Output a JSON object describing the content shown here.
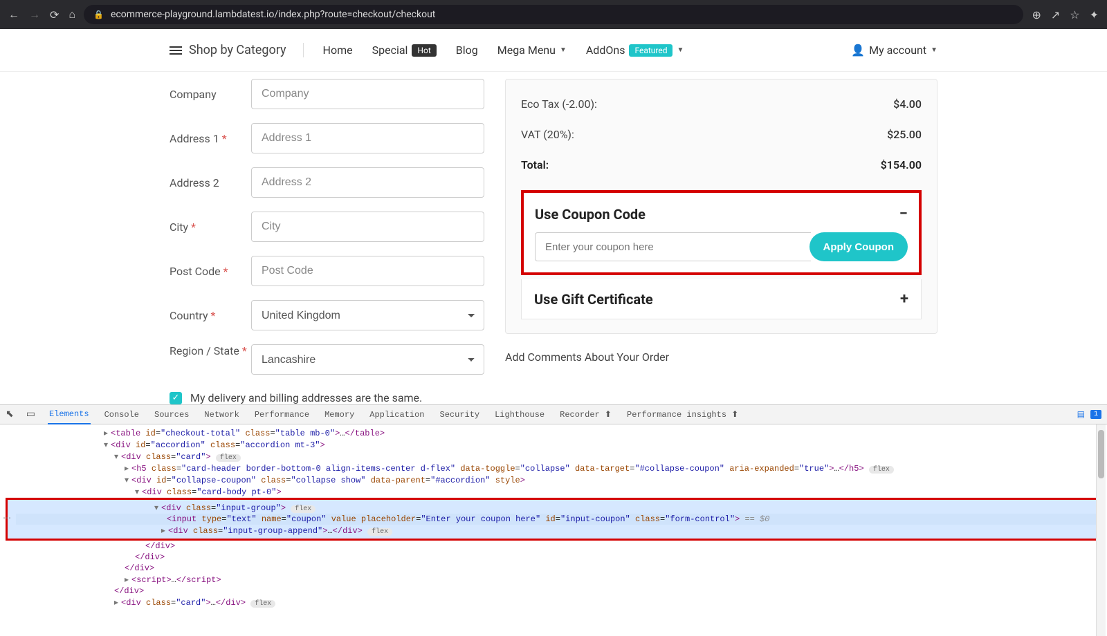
{
  "browser": {
    "url": "ecommerce-playground.lambdatest.io/index.php?route=checkout/checkout"
  },
  "nav": {
    "shop_by_category": "Shop by Category",
    "home": "Home",
    "special": "Special",
    "hot": "Hot",
    "blog": "Blog",
    "mega_menu": "Mega Menu",
    "addons": "AddOns",
    "featured": "Featured",
    "my_account": "My account"
  },
  "form": {
    "company_label": "Company",
    "company_ph": "Company",
    "address1_label": "Address 1",
    "address1_ph": "Address 1",
    "address2_label": "Address 2",
    "address2_ph": "Address 2",
    "city_label": "City",
    "city_ph": "City",
    "postcode_label": "Post Code",
    "postcode_ph": "Post Code",
    "country_label": "Country",
    "country_value": "United Kingdom",
    "region_label": "Region / State",
    "region_value": "Lancashire",
    "same_address": "My delivery and billing addresses are the same."
  },
  "summary": {
    "eco_label": "Eco Tax (-2.00):",
    "eco_value": "$4.00",
    "vat_label": "VAT (20%):",
    "vat_value": "$25.00",
    "total_label": "Total:",
    "total_value": "$154.00"
  },
  "coupon": {
    "title": "Use Coupon Code",
    "placeholder": "Enter your coupon here",
    "apply": "Apply Coupon"
  },
  "gift": {
    "title": "Use Gift Certificate"
  },
  "comments_label": "Add Comments About Your Order",
  "devtools": {
    "tabs": [
      "Elements",
      "Console",
      "Sources",
      "Network",
      "Performance",
      "Memory",
      "Application",
      "Security",
      "Lighthouse",
      "Recorder",
      "Performance insights"
    ],
    "msg_count": "1",
    "lines": {
      "l0": "▸<table id=\"checkout-total\" class=\"table mb-0\">…</table>",
      "l1": "▾<div id=\"accordion\" class=\"accordion mt-3\">",
      "l2": "▾<div class=\"card\">",
      "l3": "▸<h5 class=\"card-header border-bottom-0 align-items-center d-flex\" data-toggle=\"collapse\" data-target=\"#collapse-coupon\" aria-expanded=\"true\">…</h5>",
      "l4": "▾<div id=\"collapse-coupon\" class=\"collapse show\" data-parent=\"#accordion\" style>",
      "l5": "▾<div class=\"card-body pt-0\">",
      "l6": "▾<div class=\"input-group\">",
      "l7": "<input type=\"text\" name=\"coupon\" value placeholder=\"Enter your coupon here\" id=\"input-coupon\" class=\"form-control\">",
      "l7_tail": " == $0",
      "l8": "▸<div class=\"input-group-append\">…</div>",
      "l9": "</div>",
      "l10": "</div>",
      "l11": "</div>",
      "l12": "▸<script>…</script>",
      "l13": "</div>",
      "l14": "▸<div class=\"card\">…</div>"
    }
  }
}
